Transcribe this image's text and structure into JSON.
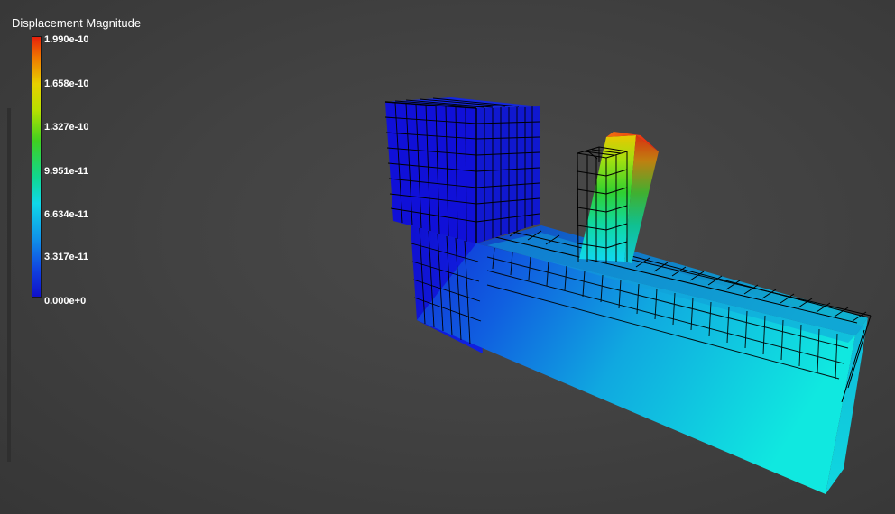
{
  "legend": {
    "title": "Displacement Magnitude",
    "labels": [
      "1.990e-10",
      "1.658e-10",
      "1.327e-10",
      "9.951e-11",
      "6.634e-11",
      "3.317e-11",
      "0.000e+0"
    ],
    "colormap": [
      "#e8200c",
      "#f07800",
      "#e8d000",
      "#40d020",
      "#10d8e8",
      "#1040e0",
      "#1010c8"
    ]
  },
  "model": {
    "colors": {
      "low": "#1010d8",
      "mid": "#10c8e8",
      "high": "#e82010",
      "mesh": "#000000"
    }
  }
}
